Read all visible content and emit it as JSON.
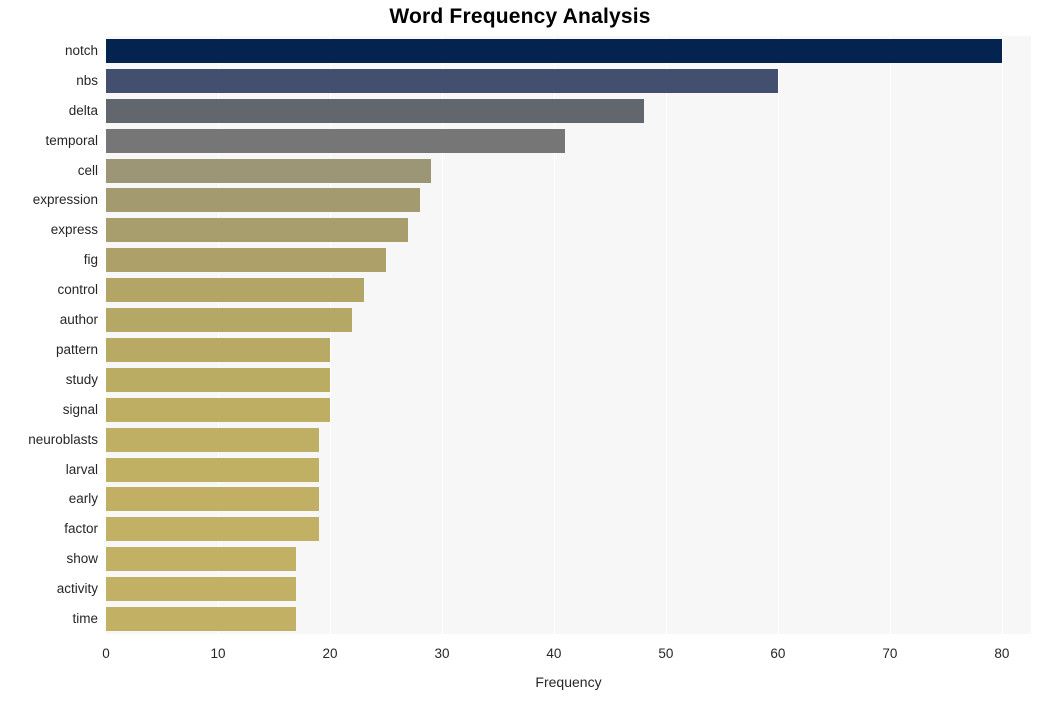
{
  "chart_data": {
    "type": "bar",
    "orientation": "horizontal",
    "title": "Word Frequency Analysis",
    "xlabel": "Frequency",
    "ylabel": "",
    "categories": [
      "notch",
      "nbs",
      "delta",
      "temporal",
      "cell",
      "expression",
      "express",
      "fig",
      "control",
      "author",
      "pattern",
      "study",
      "signal",
      "neuroblasts",
      "larval",
      "early",
      "factor",
      "show",
      "activity",
      "time"
    ],
    "values": [
      80,
      60,
      48,
      41,
      29,
      28,
      27,
      25,
      23,
      22,
      20,
      20,
      20,
      19,
      19,
      19,
      19,
      17,
      17,
      17
    ],
    "bar_colors": [
      "#04244f",
      "#434f6e",
      "#62676e",
      "#767676",
      "#9c9576",
      "#a39a70",
      "#a89d6c",
      "#ad a169",
      "#b2a566",
      "#b5a765",
      "#b8aa64",
      "#bbac64",
      "#bdae64",
      "#bfaf64",
      "#c0b064",
      "#c1b064",
      "#c2b164",
      "#c2b164",
      "#c2b164",
      "#c2b164"
    ],
    "xlim": [
      0,
      82.6
    ],
    "xticks": [
      0,
      10,
      20,
      30,
      40,
      50,
      60,
      70,
      80
    ],
    "xtick_labels": [
      "0",
      "10",
      "20",
      "30",
      "40",
      "50",
      "60",
      "70",
      "80"
    ],
    "grid": "vertical-white-on-gray",
    "legend": "none",
    "plot_background": "#f7f7f7",
    "figure_background": "#ffffff"
  }
}
